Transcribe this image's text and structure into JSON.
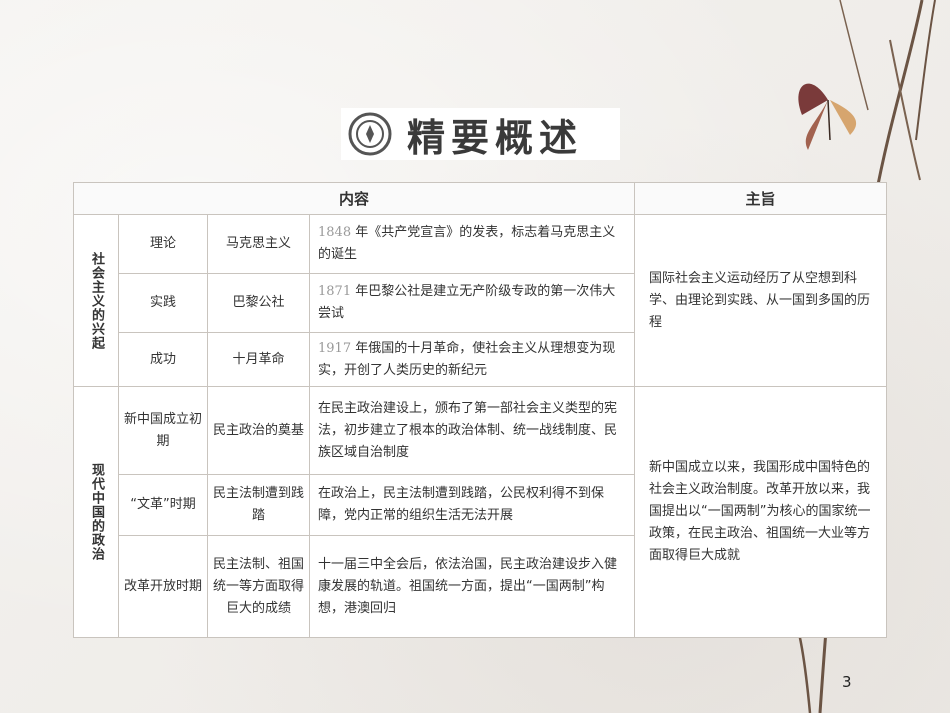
{
  "title": "精要概述",
  "table": {
    "headers": [
      "内容",
      "主旨"
    ],
    "groups": [
      {
        "label": "社会主义的兴起",
        "aim": "国际社会主义运动经历了从空想到科学、由理论到实践、从一国到多国的历程",
        "rows": [
          {
            "stage": "理论",
            "topic": "马克思主义",
            "year": "1848",
            "desc": " 年《共产党宣言》的发表，标志着马克思主义的诞生"
          },
          {
            "stage": "实践",
            "topic": "巴黎公社",
            "year": "1871",
            "desc": " 年巴黎公社是建立无产阶级专政的第一次伟大尝试"
          },
          {
            "stage": "成功",
            "topic": "十月革命",
            "year": "1917",
            "desc": " 年俄国的十月革命，使社会主义从理想变为现实，开创了人类历史的新纪元"
          }
        ]
      },
      {
        "label": "现代中国的政治",
        "aim": "新中国成立以来，我国形成中国特色的社会主义政治制度。改革开放以来，我国提出以“一国两制”为核心的国家统一政策，在民主政治、祖国统一大业等方面取得巨大成就",
        "rows": [
          {
            "stage": "新中国成立初期",
            "topic": "民主政治的奠基",
            "year": "",
            "desc": "在民主政治建设上，颁布了第一部社会主义类型的宪法，初步建立了根本的政治体制、统一战线制度、民族区域自治制度"
          },
          {
            "stage": "“文革”时期",
            "topic": "民主法制遭到践踏",
            "year": "",
            "desc": "在政治上，民主法制遭到践踏，公民权利得不到保障，党内正常的组织生活无法开展"
          },
          {
            "stage": "改革开放时期",
            "topic": "民主法制、祖国统一等方面取得巨大的成绩",
            "year": "",
            "desc": "十一届三中全会后，依法治国，民主政治建设步入健康发展的轨道。祖国统一方面，提出“一国两制”构想，港澳回归"
          }
        ]
      }
    ]
  },
  "page_number": "3"
}
